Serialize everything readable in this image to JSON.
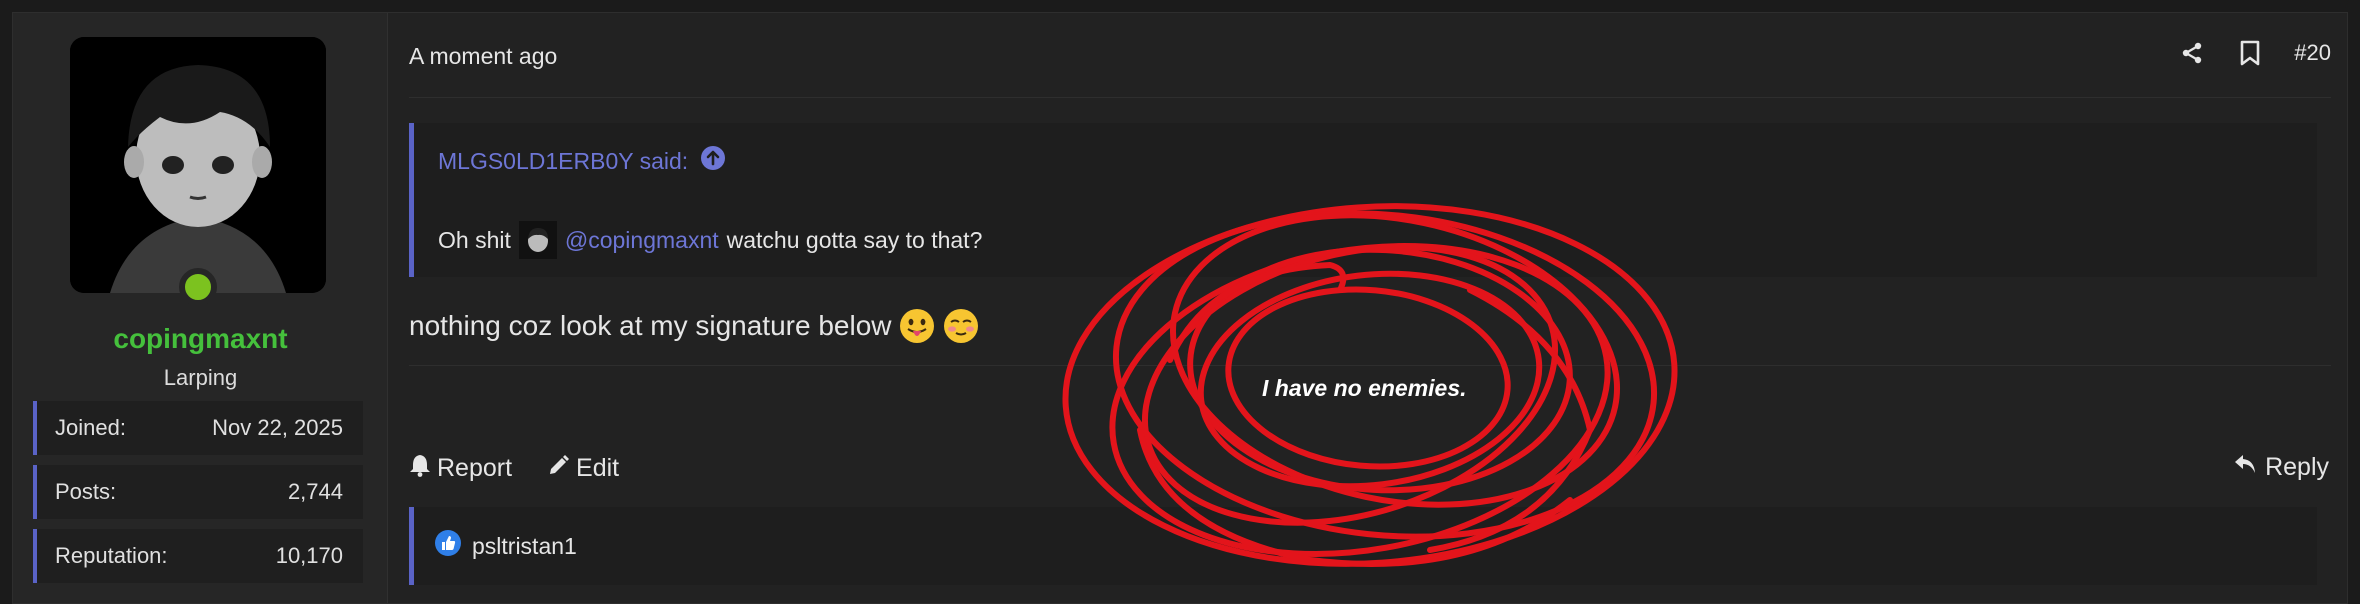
{
  "user": {
    "username": "copingmaxnt",
    "title": "Larping",
    "stats": [
      {
        "label": "Joined:",
        "value": "Nov 22, 2025"
      },
      {
        "label": "Posts:",
        "value": "2,744"
      },
      {
        "label": "Reputation:",
        "value": "10,170"
      }
    ]
  },
  "post": {
    "timestamp": "A moment ago",
    "number": "#20",
    "quote": {
      "author_said": "MLGS0LD1ERB0Y said:",
      "prefix": "Oh shit",
      "mention": "@copingmaxnt",
      "suffix": "watchu gotta say to that?"
    },
    "message": "nothing coz look at my signature below",
    "signature_overlay": "I have no enemies.",
    "actions": {
      "report": "Report",
      "edit": "Edit",
      "reply": "Reply"
    },
    "reactions": {
      "user": "psltristan1"
    }
  },
  "colors": {
    "accent": "#5a63c7",
    "username": "#45c03c",
    "online": "#7cc21f",
    "scribble": "#e3141b"
  },
  "icons": [
    "share-icon",
    "bookmark-icon",
    "arrow-up-circle-icon",
    "bell-icon",
    "pencil-icon",
    "reply-icon",
    "thumbs-up-icon"
  ]
}
